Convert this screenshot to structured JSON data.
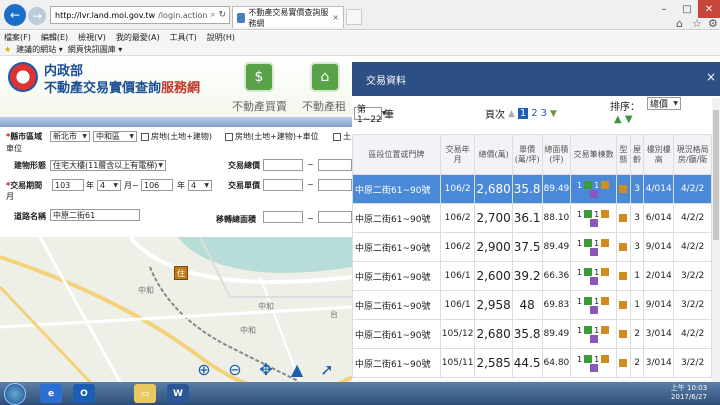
{
  "browser": {
    "url_domain": "http://lvr.land.moi.gov.tw",
    "url_path": "/login.action",
    "tab_title": "不動產交易實價查詢服務網",
    "menu": [
      "檔案(F)",
      "編輯(E)",
      "檢視(V)",
      "我的最愛(A)",
      "工具(T)",
      "說明(H)"
    ],
    "favorites": [
      "建議的網站 ▾",
      "網頁快訊圖庫 ▾"
    ]
  },
  "site": {
    "dept": "内政部",
    "title_main": "不動產交易實價查詢",
    "title_accent": "服務網",
    "link1": "不動產買賣",
    "link2": "不動產租"
  },
  "form": {
    "county_label": "縣市區域",
    "county_value": "新北市",
    "district_value": "中和區",
    "cb1_label": "房地(土地+建物)",
    "cb2_label": "房地(土地+建物)+車位",
    "cb3_label": "土",
    "unit_label": "車位",
    "type_label": "建物形態",
    "type_value": "住宅大樓(11層含以上有電梯)",
    "total_price_label": "交易總價",
    "period_label": "交易期間",
    "period_year_from": "103",
    "period_month_from": "4",
    "period_year_to": "106",
    "period_month_to": "4",
    "year_unit": "年",
    "month_unit": "月",
    "month_to": "月~",
    "month_end": "月",
    "unit_price_label": "交易單價",
    "road_label": "道路名稱",
    "road_value": "中原二街61",
    "area_label": "移轉總面積",
    "tilde": "~"
  },
  "map": {
    "pin_label": "住",
    "labels": [
      "中和",
      "中和",
      "中和",
      "台"
    ]
  },
  "panel": {
    "title": "交易資料",
    "page_range": "第1~22",
    "page_suffix": "筆",
    "pages_label": "頁次",
    "pages": [
      "1",
      "2",
      "3"
    ],
    "sort_label": "排序：",
    "sort_value": "總價",
    "columns": [
      "區段位置或門牌",
      "交易年月",
      "總價(萬)",
      "單價(萬/坪)",
      "總面積(坪)",
      "交易筆棟數",
      "型態",
      "屋齡",
      "樓別樓高",
      "現況格局房/廳/衛"
    ],
    "rows": [
      {
        "loc": "中原二街61~90號",
        "ym": "106/2",
        "total": "2,680",
        "unit": "35.8",
        "area": "89.49",
        "c": [
          "1",
          "1",
          "2"
        ],
        "age": "3",
        "floor": "4/014",
        "layout": "4/2/2"
      },
      {
        "loc": "中原二街61~90號",
        "ym": "106/2",
        "total": "2,700",
        "unit": "36.1",
        "area": "88.10",
        "c": [
          "1",
          "1",
          "2"
        ],
        "age": "3",
        "floor": "6/014",
        "layout": "4/2/2"
      },
      {
        "loc": "中原二街61~90號",
        "ym": "106/2",
        "total": "2,900",
        "unit": "37.5",
        "area": "89.49",
        "c": [
          "1",
          "1",
          "2"
        ],
        "age": "3",
        "floor": "9/014",
        "layout": "4/2/2"
      },
      {
        "loc": "中原二街61~90號",
        "ym": "106/1",
        "total": "2,600",
        "unit": "39.2",
        "area": "66.36",
        "c": [
          "1",
          "1",
          "1"
        ],
        "age": "1",
        "floor": "2/014",
        "layout": "3/2/2"
      },
      {
        "loc": "中原二街61~90號",
        "ym": "106/1",
        "total": "2,958",
        "unit": "48",
        "area": "69.83",
        "c": [
          "1",
          "1",
          "1"
        ],
        "age": "1",
        "floor": "9/014",
        "layout": "3/2/2"
      },
      {
        "loc": "中原二街61~90號",
        "ym": "105/12",
        "total": "2,680",
        "unit": "35.8",
        "area": "89.49",
        "c": [
          "1",
          "1",
          "2"
        ],
        "age": "2",
        "floor": "3/014",
        "layout": "4/2/2"
      },
      {
        "loc": "中原二街61~90號",
        "ym": "105/11",
        "total": "2,585",
        "unit": "44.5",
        "area": "64.80",
        "c": [
          "1",
          "1",
          "1"
        ],
        "age": "2",
        "floor": "3/014",
        "layout": "3/2/2"
      }
    ]
  },
  "taskbar": {
    "time": "上午 10:03",
    "date": "2017/6/27"
  }
}
